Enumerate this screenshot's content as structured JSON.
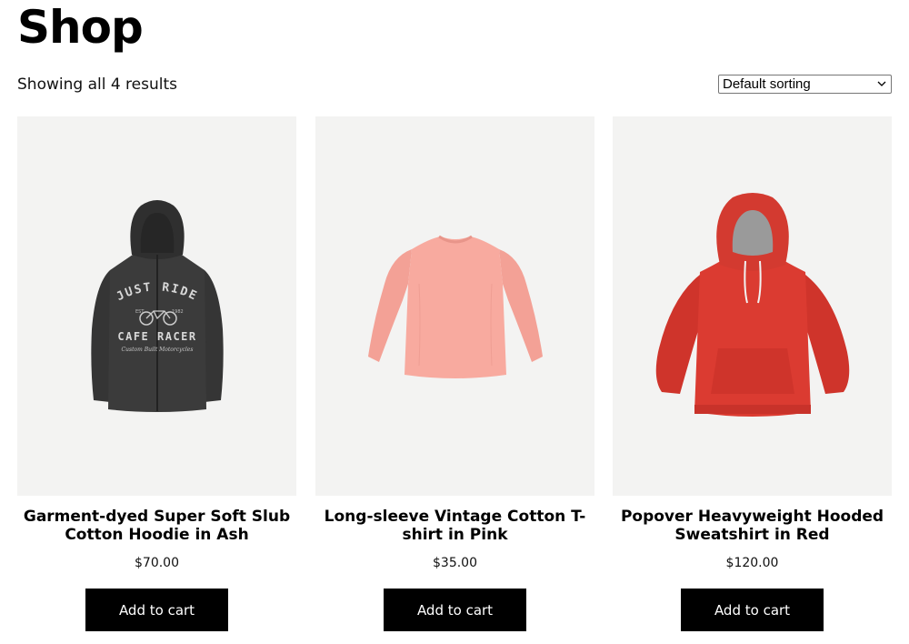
{
  "page": {
    "title": "Shop",
    "result_count": "Showing all 4 results",
    "sorting": {
      "selected": "Default sorting"
    }
  },
  "products": [
    {
      "title": "Garment-dyed Super Soft Slub Cotton Hoodie in Ash",
      "price": "$70.00",
      "button": "Add to cart",
      "image": {
        "icon": "zip-hoodie",
        "color": "#3a3a3a",
        "print": {
          "top": "JUST RIDE",
          "middle": "CAFE RACER",
          "bottom": "Custom Built Motorcycles",
          "est": "EST",
          "year": "1982"
        }
      }
    },
    {
      "title": "Long-sleeve Vintage Cotton T-shirt in Pink",
      "price": "$35.00",
      "button": "Add to cart",
      "image": {
        "icon": "long-sleeve-shirt",
        "color": "#f6a89c"
      }
    },
    {
      "title": "Popover Heavyweight Hooded Sweatshirt in Red",
      "price": "$120.00",
      "button": "Add to cart",
      "image": {
        "icon": "pullover-hoodie",
        "color": "#d83a30"
      }
    }
  ]
}
